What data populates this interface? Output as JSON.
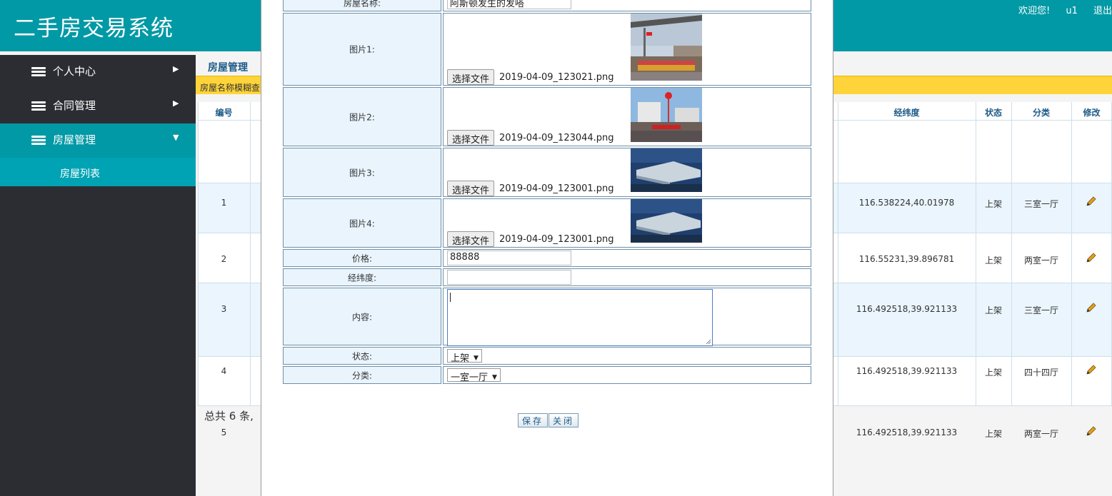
{
  "header": {
    "title": "二手房交易系统",
    "welcome": "欢迎您!",
    "username": "u1",
    "logout": "退出"
  },
  "sidebar": {
    "items": [
      {
        "label": "个人中心",
        "arrow": "▶"
      },
      {
        "label": "合同管理",
        "arrow": "▶"
      },
      {
        "label": "房屋管理",
        "arrow": "▼"
      }
    ],
    "subitems": [
      {
        "label": "房屋列表"
      }
    ]
  },
  "main": {
    "breadcrumb": "房屋管理",
    "search_label": "房屋名称模糊查",
    "columns": [
      "编号",
      "经纬度",
      "状态",
      "分类",
      "修改"
    ],
    "rows": [
      {
        "id": "1",
        "coords": "116.538224,40.01978",
        "status": "上架",
        "category": "三室一厅"
      },
      {
        "id": "2",
        "coords": "116.55231,39.896781",
        "status": "上架",
        "category": "两室一厅"
      },
      {
        "id": "3",
        "coords": "116.492518,39.921133",
        "status": "上架",
        "category": "三室一厅"
      },
      {
        "id": "4",
        "coords": "116.492518,39.921133",
        "status": "上架",
        "category": "四十四厅"
      },
      {
        "id": "5",
        "coords": "116.492518,39.921133",
        "status": "上架",
        "category": "两室一厅"
      }
    ],
    "total": "总共 6 条,"
  },
  "modal": {
    "name_label": "房屋名称:",
    "name_value": "阿斯顿发生的发嗒",
    "images": [
      {
        "label": "图片1:",
        "button": "选择文件",
        "filename": "2019-04-09_123021.png"
      },
      {
        "label": "图片2:",
        "button": "选择文件",
        "filename": "2019-04-09_123044.png"
      },
      {
        "label": "图片3:",
        "button": "选择文件",
        "filename": "2019-04-09_123001.png"
      },
      {
        "label": "图片4:",
        "button": "选择文件",
        "filename": "2019-04-09_123001.png"
      }
    ],
    "price_label": "价格:",
    "price_value": "88888",
    "coords_label": "经纬度:",
    "coords_value": "",
    "content_label": "内容:",
    "status_label": "状态:",
    "status_value": "上架",
    "category_label": "分类:",
    "category_value": "一室一厅",
    "save_button": "保存",
    "close_button": "关闭"
  }
}
